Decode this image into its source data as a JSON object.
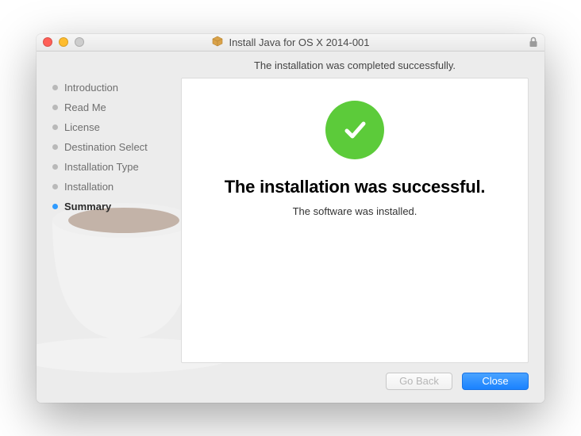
{
  "window": {
    "title": "Install Java for OS X 2014-001"
  },
  "sidebar": {
    "steps": [
      {
        "label": "Introduction",
        "active": false
      },
      {
        "label": "Read Me",
        "active": false
      },
      {
        "label": "License",
        "active": false
      },
      {
        "label": "Destination Select",
        "active": false
      },
      {
        "label": "Installation Type",
        "active": false
      },
      {
        "label": "Installation",
        "active": false
      },
      {
        "label": "Summary",
        "active": true
      }
    ]
  },
  "main": {
    "subtitle": "The installation was completed successfully.",
    "headline": "The installation was successful.",
    "subline": "The software was installed."
  },
  "footer": {
    "go_back": "Go Back",
    "close": "Close"
  }
}
